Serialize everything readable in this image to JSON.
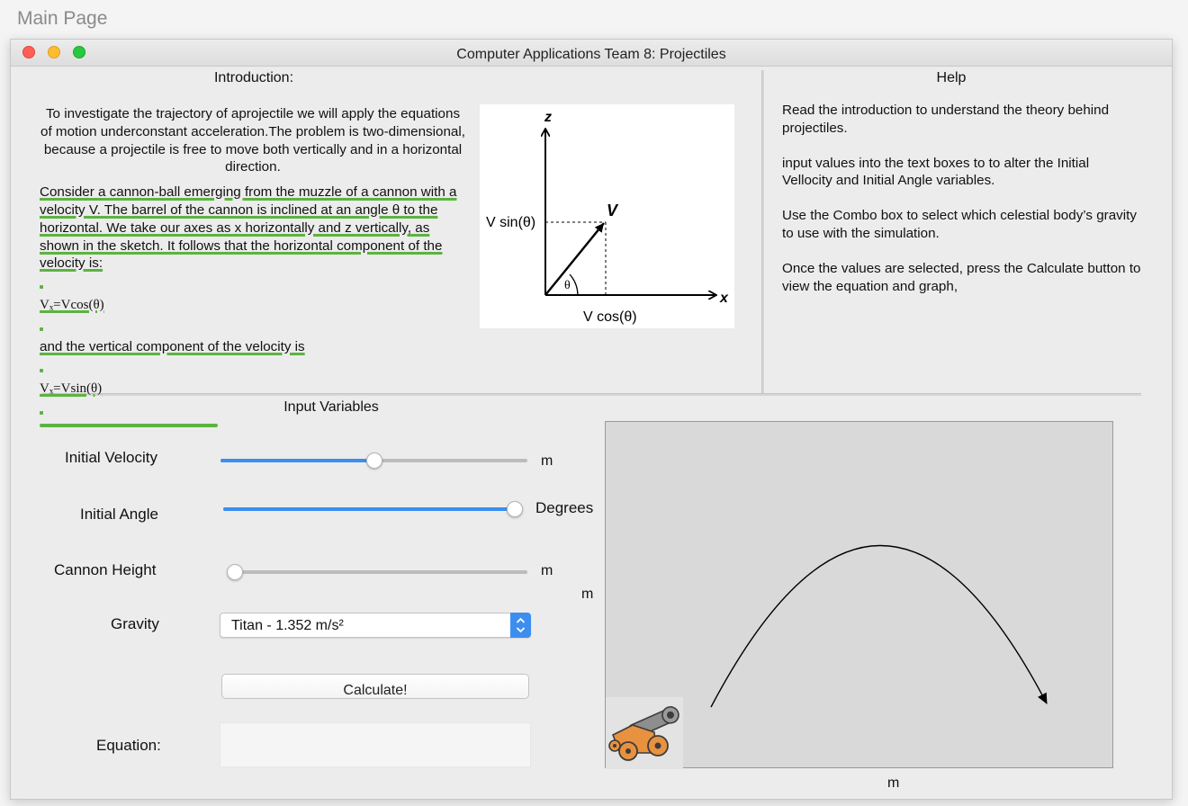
{
  "page": {
    "title": "Main Page"
  },
  "window": {
    "title": "Computer Applications Team 8: Projectiles"
  },
  "intro": {
    "heading": "Introduction:",
    "paragraph1": "To investigate the trajectory of aprojectile we will apply the equations of motion underconstant acceleration.The problem is two-dimensional, because a projectile is free to move both vertically and in a horizontal direction.",
    "paragraph2": "Consider a cannon-ball emerging from the muzzle of a cannon with a velocity V. The barrel of the cannon is inclined at an angle θ to the horizontal. We take our axes as x horizontally and z vertically, as shown in the sketch. It follows that the horizontal component of the velocity is:",
    "formula1": "Vₓ=Vcos(θ)",
    "paragraph3": "and the vertical component of the velocity is",
    "formula2": "Vₓ=Vsin(θ)"
  },
  "diagram": {
    "z_label": "z",
    "x_label": "x",
    "v_label": "V",
    "vsin_label": "V sin(θ)",
    "vcos_label": "V cos(θ)",
    "theta_label": "θ"
  },
  "help": {
    "heading": "Help",
    "items": [
      "Read the introduction to understand the theory behind projectiles.",
      "input values into the text boxes to to alter the Initial Vellocity and Initial Angle variables.",
      "Use the Combo box to select which celestial body’s gravity to use with the simulation.",
      "Once the values are selected, press the Calculate button to view the equation and graph,"
    ]
  },
  "inputs": {
    "heading": "Input Variables",
    "initial_velocity": {
      "label": "Initial Velocity",
      "unit": "m",
      "fraction": 0.5
    },
    "initial_angle": {
      "label": "Initial Angle",
      "unit": "Degrees",
      "fraction": 1.0
    },
    "cannon_height": {
      "label": "Cannon Height",
      "unit": "m",
      "fraction": 0.0
    },
    "gravity": {
      "label": "Gravity",
      "selected": "Titan - 1.352 m/s²"
    },
    "calculate_label": "Calculate!",
    "equation_label": "Equation:",
    "equation_value": ""
  },
  "graph": {
    "x_unit": "m",
    "y_unit": "m"
  },
  "colors": {
    "accent": "#3b8ef0",
    "highlight": "#5cb342",
    "cannon_body": "#e8923f",
    "cannon_barrel": "#8a8a8a"
  }
}
